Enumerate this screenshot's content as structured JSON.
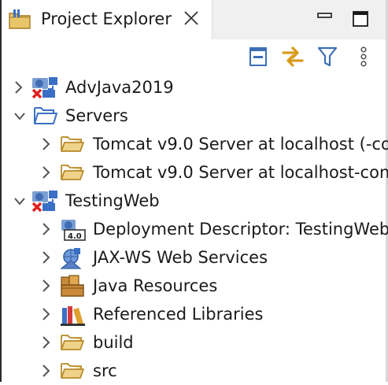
{
  "view": {
    "title": "Project Explorer"
  },
  "tree": {
    "items": [
      {
        "label": "AdvJava2019",
        "icon": "web-project-error-icon",
        "depth": 0,
        "expanded": false
      },
      {
        "label": "Servers",
        "icon": "open-folder-icon",
        "depth": 0,
        "expanded": true
      },
      {
        "label": "Tomcat v9.0 Server at localhost (-co",
        "icon": "folder-icon",
        "depth": 1,
        "expanded": false
      },
      {
        "label": "Tomcat v9.0 Server at localhost-con",
        "icon": "folder-icon",
        "depth": 1,
        "expanded": false
      },
      {
        "label": "TestingWeb",
        "icon": "web-project-error-icon",
        "depth": 0,
        "expanded": true
      },
      {
        "label": "Deployment Descriptor: TestingWeb",
        "icon": "deployment-descriptor-icon",
        "depth": 1,
        "expanded": false
      },
      {
        "label": "JAX-WS Web Services",
        "icon": "web-services-icon",
        "depth": 1,
        "expanded": false
      },
      {
        "label": "Java Resources",
        "icon": "java-resources-icon",
        "depth": 1,
        "expanded": false
      },
      {
        "label": "Referenced Libraries",
        "icon": "libraries-icon",
        "depth": 1,
        "expanded": false
      },
      {
        "label": "build",
        "icon": "folder-icon",
        "depth": 1,
        "expanded": false
      },
      {
        "label": "src",
        "icon": "folder-icon",
        "depth": 1,
        "expanded": false
      }
    ]
  }
}
